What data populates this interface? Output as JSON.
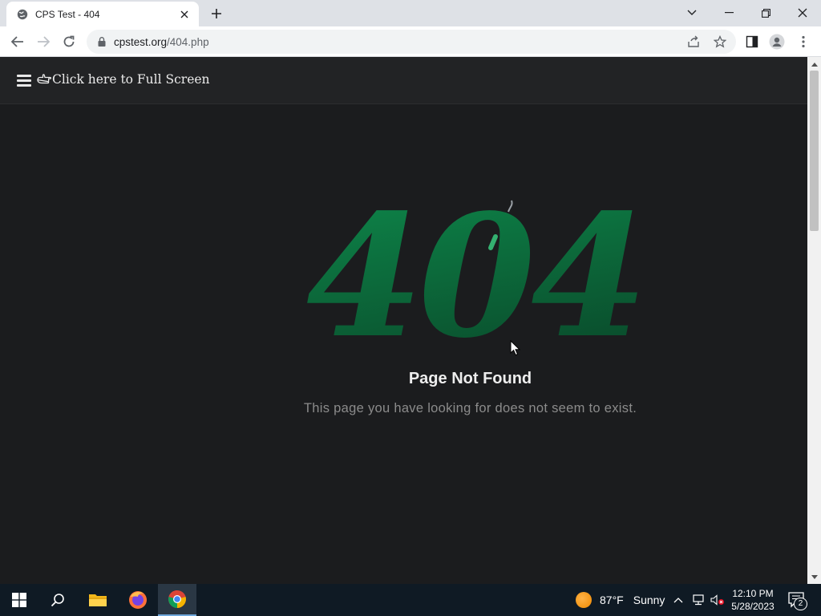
{
  "browser": {
    "tab_title": "CPS Test - 404",
    "url_domain": "cpstest.org",
    "url_path": "/404.php"
  },
  "header": {
    "fullscreen_label": "Click here to Full Screen"
  },
  "error": {
    "code": "404",
    "title": "Page Not Found",
    "description": "This page you have looking for does not seem to exist."
  },
  "taskbar": {
    "weather_temp": "87°F",
    "weather_condition": "Sunny",
    "time": "12:10 PM",
    "date": "5/28/2023",
    "notification_count": "2"
  },
  "colors": {
    "page_bg": "#1b1c1e",
    "header_bg": "#222325",
    "accent_green": "#0b7d44",
    "taskbar_bg": "#0f1a24"
  }
}
